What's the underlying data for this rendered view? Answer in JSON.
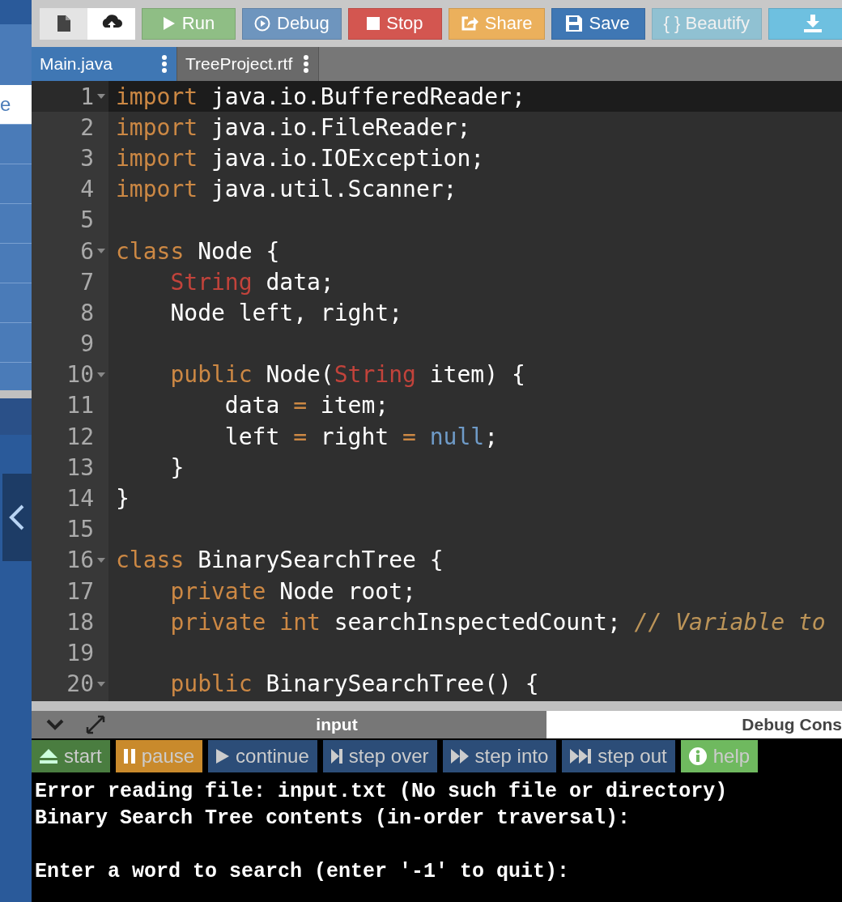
{
  "sidebar": {
    "items": [
      {
        "label": "e",
        "selected": true
      }
    ]
  },
  "toolbar": {
    "icon_buttons": [
      {
        "kind": "new-file",
        "selected": false
      },
      {
        "kind": "upload",
        "selected": true
      }
    ],
    "buttons": [
      {
        "label": "Run",
        "kind": "run",
        "disabled": false
      },
      {
        "label": "Debug",
        "kind": "debug",
        "disabled": false
      },
      {
        "label": "Stop",
        "kind": "stop",
        "disabled": false
      },
      {
        "label": "Share",
        "kind": "share",
        "disabled": false
      },
      {
        "label": "Save",
        "kind": "save",
        "disabled": false
      },
      {
        "label": "{ } Beautify",
        "kind": "beautify",
        "disabled": true
      },
      {
        "kind": "download",
        "disabled": false
      }
    ]
  },
  "tabs": [
    {
      "label": "Main.java",
      "selected": true
    },
    {
      "label": "TreeProject.rtf",
      "selected": false
    }
  ],
  "editor": {
    "lines": [
      {
        "n": "1",
        "fold": true,
        "active": true,
        "tokens": [
          {
            "kind": "keyword",
            "t": "import"
          },
          {
            "kind": "plain",
            "t": " java.io.BufferedReader;"
          }
        ]
      },
      {
        "n": "2",
        "fold": false,
        "active": false,
        "tokens": [
          {
            "kind": "keyword",
            "t": "import"
          },
          {
            "kind": "plain",
            "t": " java.io.FileReader;"
          }
        ]
      },
      {
        "n": "3",
        "fold": false,
        "active": false,
        "tokens": [
          {
            "kind": "keyword",
            "t": "import"
          },
          {
            "kind": "plain",
            "t": " java.io.IOException;"
          }
        ]
      },
      {
        "n": "4",
        "fold": false,
        "active": false,
        "tokens": [
          {
            "kind": "keyword",
            "t": "import"
          },
          {
            "kind": "plain",
            "t": " java.util.Scanner;"
          }
        ]
      },
      {
        "n": "5",
        "fold": false,
        "active": false
      },
      {
        "n": "6",
        "fold": true,
        "active": false,
        "tokens": [
          {
            "kind": "keyword",
            "t": "class"
          },
          {
            "kind": "plain",
            "t": " Node {"
          }
        ]
      },
      {
        "n": "7",
        "fold": false,
        "active": false,
        "tokens": [
          {
            "kind": "type",
            "t": "    String"
          },
          {
            "kind": "plain",
            "t": " data;"
          }
        ]
      },
      {
        "n": "8",
        "fold": false,
        "active": false,
        "tokens": [
          {
            "kind": "plain",
            "t": "    Node left, right;"
          }
        ]
      },
      {
        "n": "9",
        "fold": false,
        "active": false
      },
      {
        "n": "10",
        "fold": true,
        "active": false,
        "tokens": [
          {
            "kind": "keyword",
            "t": "    public"
          },
          {
            "kind": "plain",
            "t": " Node("
          },
          {
            "kind": "type",
            "t": "String"
          },
          {
            "kind": "plain",
            "t": " item) {"
          }
        ]
      },
      {
        "n": "11",
        "fold": false,
        "active": false,
        "tokens": [
          {
            "kind": "plain",
            "t": "        data "
          },
          {
            "kind": "operator",
            "t": "="
          },
          {
            "kind": "plain",
            "t": " item;"
          }
        ]
      },
      {
        "n": "12",
        "fold": false,
        "active": false,
        "tokens": [
          {
            "kind": "plain",
            "t": "        left "
          },
          {
            "kind": "operator",
            "t": "="
          },
          {
            "kind": "plain",
            "t": " right "
          },
          {
            "kind": "operator",
            "t": "="
          },
          {
            "kind": "literal",
            "t": " null"
          },
          {
            "kind": "plain",
            "t": ";"
          }
        ]
      },
      {
        "n": "13",
        "fold": false,
        "active": false,
        "tokens": [
          {
            "kind": "plain",
            "t": "    }"
          }
        ]
      },
      {
        "n": "14",
        "fold": false,
        "active": false,
        "tokens": [
          {
            "kind": "plain",
            "t": "}"
          }
        ]
      },
      {
        "n": "15",
        "fold": false,
        "active": false
      },
      {
        "n": "16",
        "fold": true,
        "active": false,
        "tokens": [
          {
            "kind": "keyword",
            "t": "class"
          },
          {
            "kind": "plain",
            "t": " BinarySearchTree {"
          }
        ]
      },
      {
        "n": "17",
        "fold": false,
        "active": false,
        "tokens": [
          {
            "kind": "keyword",
            "t": "    private"
          },
          {
            "kind": "plain",
            "t": " Node root;"
          }
        ]
      },
      {
        "n": "18",
        "fold": false,
        "active": false,
        "tokens": [
          {
            "kind": "keyword",
            "t": "    private"
          },
          {
            "kind": "keyword",
            "t": " int"
          },
          {
            "kind": "plain",
            "t": " searchInspectedCount; "
          },
          {
            "kind": "comment",
            "t": "// Variable to"
          }
        ]
      },
      {
        "n": "19",
        "fold": false,
        "active": false
      },
      {
        "n": "20",
        "fold": true,
        "active": false,
        "tokens": [
          {
            "kind": "keyword",
            "t": "    public"
          },
          {
            "kind": "plain",
            "t": " BinarySearchTree() {"
          }
        ]
      }
    ]
  },
  "bottom_tabs": [
    {
      "label": "input",
      "selected": false
    },
    {
      "label": "Debug Cons",
      "selected": true
    }
  ],
  "debug_buttons": [
    {
      "label": "start",
      "kind": "start"
    },
    {
      "label": "pause",
      "kind": "pause"
    },
    {
      "label": "continue",
      "kind": "continue"
    },
    {
      "label": "step over",
      "kind": "step-over"
    },
    {
      "label": "step into",
      "kind": "step-into"
    },
    {
      "label": "step out",
      "kind": "step-out"
    },
    {
      "label": "help",
      "kind": "help"
    }
  ],
  "console": [
    {
      "text": "Error reading file: input.txt (No such file or directory)",
      "blank_before": false
    },
    {
      "text": "Binary Search Tree contents (in-order traversal):",
      "blank_before": false
    },
    {
      "text": "Enter a word to search (enter '-1' to quit):",
      "blank_before": true
    }
  ]
}
